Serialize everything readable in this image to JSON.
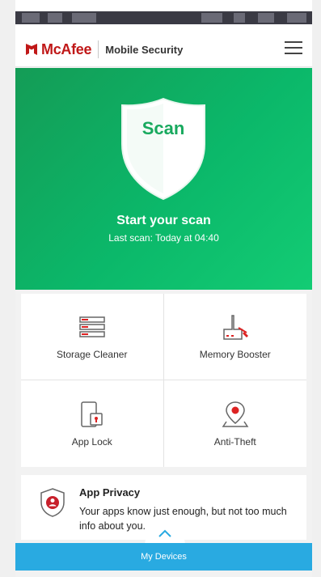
{
  "header": {
    "brand": "McAfee",
    "product": "Mobile Security",
    "brand_color": "#c01818"
  },
  "hero": {
    "scan_button": "Scan",
    "title": "Start your scan",
    "subtitle": "Last scan:  Today at 04:40",
    "accent": "#13b866"
  },
  "tiles": [
    {
      "label": "Storage Cleaner",
      "icon": "storage-icon"
    },
    {
      "label": "Memory Booster",
      "icon": "broom-icon"
    },
    {
      "label": "App Lock",
      "icon": "phone-lock-icon"
    },
    {
      "label": "Anti-Theft",
      "icon": "location-pin-icon"
    }
  ],
  "privacy": {
    "title": "App Privacy",
    "description": "Your apps know just enough, but not too much info about you.",
    "icon": "privacy-shield-icon"
  },
  "bottom_bar": {
    "label": "My Devices",
    "color": "#29aae1"
  }
}
